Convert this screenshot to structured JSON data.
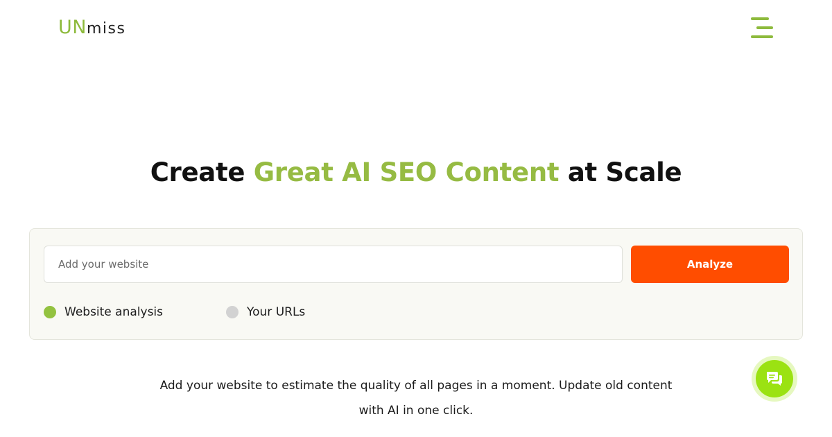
{
  "header": {
    "logo_accent": "UN",
    "logo_rest": "miss",
    "menu_icon": "hamburger-icon"
  },
  "hero": {
    "title_prefix": "Create ",
    "title_highlight": "Great AI SEO Content",
    "title_suffix": " at Scale"
  },
  "search": {
    "placeholder": "Add your website",
    "value": "",
    "analyze_label": "Analyze"
  },
  "mode_options": [
    {
      "label": "Website analysis",
      "selected": true
    },
    {
      "label": "Your URLs",
      "selected": false
    }
  ],
  "description": {
    "line1": "Add your website to estimate the quality of all pages in a moment. Update old content",
    "line2": "with AI in one click."
  },
  "chat": {
    "icon": "chat-bubbles-icon"
  },
  "colors": {
    "brand_green": "#8dba3c",
    "cta_orange": "#ff4d00",
    "chat_green": "#9be212"
  }
}
